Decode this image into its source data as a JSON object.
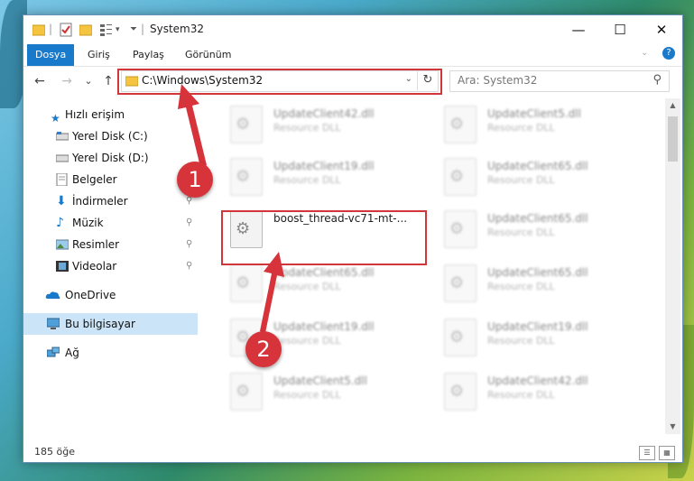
{
  "window": {
    "title": "System32",
    "minimize_glyph": "—",
    "maximize_glyph": "☐",
    "close_glyph": "✕"
  },
  "ribbon": {
    "tabs": [
      {
        "label": "Dosya",
        "active": true
      },
      {
        "label": "Giriş"
      },
      {
        "label": "Paylaş"
      },
      {
        "label": "Görünüm"
      }
    ],
    "help_glyph": "?"
  },
  "nav": {
    "back_glyph": "←",
    "forward_glyph": "→",
    "recent_glyph": "⌄",
    "up_glyph": "↑",
    "address_path": "C:\\Windows\\System32",
    "address_dropdown_glyph": "⌄",
    "refresh_glyph": "↻",
    "search_placeholder": "Ara: System32",
    "search_glyph": "⚲"
  },
  "sidebar": {
    "items": [
      {
        "label": "Hızlı erişim",
        "icon": "star-icon"
      },
      {
        "label": "Yerel Disk (C:)",
        "icon": "drive-icon"
      },
      {
        "label": "Yerel Disk (D:)",
        "icon": "drive-icon"
      },
      {
        "label": "Belgeler",
        "icon": "documents-icon",
        "pin": "📌"
      },
      {
        "label": "İndirmeler",
        "icon": "download-icon",
        "pin": "📌"
      },
      {
        "label": "Müzik",
        "icon": "music-icon",
        "pin": "📌"
      },
      {
        "label": "Resimler",
        "icon": "pictures-icon",
        "pin": "📌"
      },
      {
        "label": "Videolar",
        "icon": "videos-icon",
        "pin": "📌"
      },
      {
        "label": "OneDrive",
        "icon": "cloud-icon"
      },
      {
        "label": "Bu bilgisayar",
        "icon": "computer-icon"
      },
      {
        "label": "Ağ",
        "icon": "network-icon"
      }
    ]
  },
  "files": [
    {
      "name": "UpdateClient42.dll",
      "type": "Resource DLL"
    },
    {
      "name": "UpdateClient5.dll",
      "type": "Resource DLL"
    },
    {
      "name": "UpdateClient19.dll",
      "type": "Resource DLL"
    },
    {
      "name": "UpdateClient65.dll",
      "type": "Resource DLL"
    },
    {
      "name": "boost_thread-vc71-mt-...",
      "type": ""
    },
    {
      "name": "UpdateClient65.dll",
      "type": "Resource DLL"
    },
    {
      "name": "UpdateClient65.dll",
      "type": "Resource DLL"
    },
    {
      "name": "UpdateClient65.dll",
      "type": "Resource DLL"
    },
    {
      "name": "UpdateClient19.dll",
      "type": "Resource DLL"
    },
    {
      "name": "UpdateClient19.dll",
      "type": "Resource DLL"
    },
    {
      "name": "UpdateClient5.dll",
      "type": "Resource DLL"
    },
    {
      "name": "UpdateClient42.dll",
      "type": "Resource DLL"
    }
  ],
  "status": {
    "item_count": "185 öğe"
  },
  "annotations": {
    "step1": "1",
    "step2": "2"
  },
  "colors": {
    "accent": "#1979ca",
    "highlight_box": "#d0363a",
    "selection": "#cce4f7"
  }
}
